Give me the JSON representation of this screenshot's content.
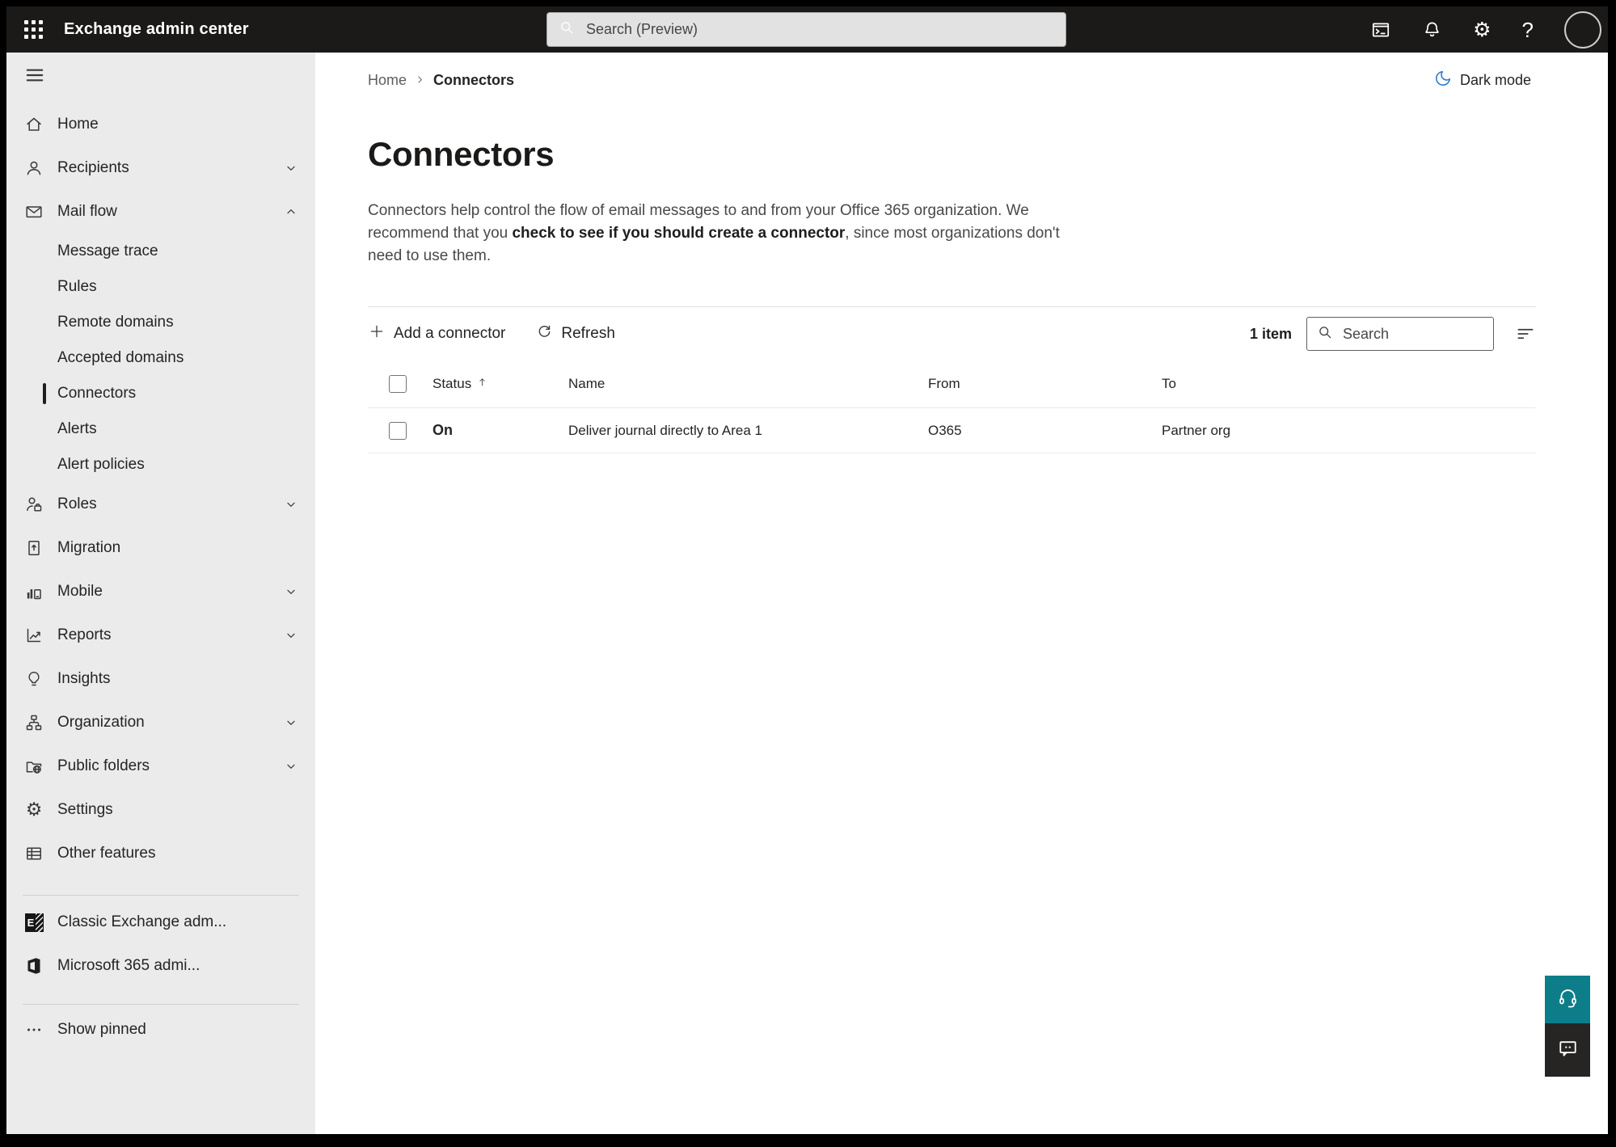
{
  "topbar": {
    "app_title": "Exchange admin center",
    "search_placeholder": "Search (Preview)",
    "help_glyph": "?",
    "gear_glyph": "⚙",
    "icons": [
      "app-launcher-icon",
      "terminal-icon",
      "bell-icon",
      "gear-icon",
      "help-icon",
      "avatar"
    ]
  },
  "sidebar": {
    "items": [
      {
        "label": "Home",
        "icon": "home-icon"
      },
      {
        "label": "Recipients",
        "icon": "person-icon",
        "chevron": "down"
      },
      {
        "label": "Mail flow",
        "icon": "mail-icon",
        "chevron": "up",
        "expanded": true
      },
      {
        "label": "Message trace",
        "sub": true
      },
      {
        "label": "Rules",
        "sub": true
      },
      {
        "label": "Remote domains",
        "sub": true
      },
      {
        "label": "Accepted domains",
        "sub": true
      },
      {
        "label": "Connectors",
        "sub": true,
        "selected": true
      },
      {
        "label": "Alerts",
        "sub": true
      },
      {
        "label": "Alert policies",
        "sub": true
      },
      {
        "label": "Roles",
        "icon": "roles-icon",
        "chevron": "down"
      },
      {
        "label": "Migration",
        "icon": "migration-icon"
      },
      {
        "label": "Mobile",
        "icon": "mobile-icon",
        "chevron": "down"
      },
      {
        "label": "Reports",
        "icon": "reports-icon",
        "chevron": "down"
      },
      {
        "label": "Insights",
        "icon": "insights-icon"
      },
      {
        "label": "Organization",
        "icon": "organization-icon",
        "chevron": "down"
      },
      {
        "label": "Public folders",
        "icon": "public-folders-icon",
        "chevron": "down"
      },
      {
        "label": "Settings",
        "icon": "gear-icon"
      },
      {
        "label": "Other features",
        "icon": "table-icon"
      },
      {
        "label": "Classic Exchange adm...",
        "icon": "classic-exchange-icon"
      },
      {
        "label": "Microsoft 365 admi...",
        "icon": "microsoft-365-icon"
      },
      {
        "label": "Show pinned",
        "icon": "more-icon"
      }
    ]
  },
  "breadcrumb": {
    "home": "Home",
    "current": "Connectors"
  },
  "dark_mode_label": "Dark mode",
  "page": {
    "title": "Connectors",
    "description_1": "Connectors help control the flow of email messages to and from your Office 365 organization. We recommend that you ",
    "description_link": "check to see if you should create a connector",
    "description_2": ", since most organizations don't need to use them."
  },
  "toolbar": {
    "add_label": "Add a connector",
    "refresh_label": "Refresh",
    "item_count": "1 item",
    "search_placeholder": "Search"
  },
  "table": {
    "columns": {
      "status": "Status",
      "name": "Name",
      "from": "From",
      "to": "To"
    },
    "sort": {
      "column": "Status",
      "direction": "ascending"
    },
    "rows": [
      {
        "status": "On",
        "name": "Deliver journal directly to Area 1",
        "from": "O365",
        "to": "Partner org"
      }
    ]
  },
  "colors": {
    "topbar_bg": "#1b1a19",
    "sidebar_bg": "#ebebeb",
    "accent_blue": "#2e7ac7",
    "help_teal": "#0e7d8a",
    "feedback_dark": "#262524",
    "selected_indicator": "#1f1f1f"
  }
}
